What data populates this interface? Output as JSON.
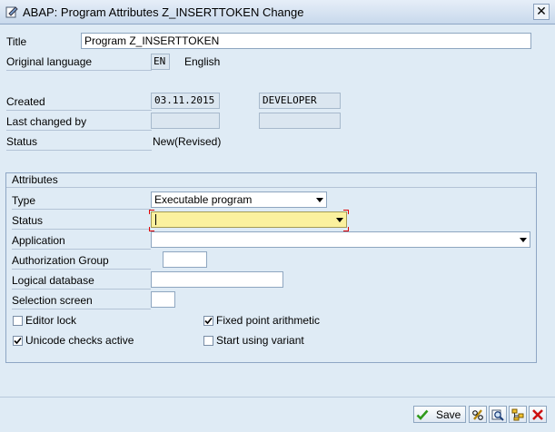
{
  "window": {
    "title": "ABAP: Program Attributes Z_INSERTTOKEN Change",
    "close_glyph": "✕"
  },
  "header": {
    "title_label": "Title",
    "title_value": "Program Z_INSERTTOKEN",
    "orig_lang_label": "Original language",
    "orig_lang_code": "EN",
    "orig_lang_name": "English",
    "created_label": "Created",
    "created_date": "03.11.2015",
    "created_user": "DEVELOPER",
    "last_changed_label": "Last changed by",
    "last_changed_date": "",
    "last_changed_user": "",
    "status_label": "Status",
    "status_value": "New(Revised)"
  },
  "attributes": {
    "group_title": "Attributes",
    "type_label": "Type",
    "type_value": "Executable program",
    "status_label": "Status",
    "status_value": "",
    "application_label": "Application",
    "application_value": "",
    "auth_group_label": "Authorization Group",
    "auth_group_value": "",
    "logical_db_label": "Logical database",
    "logical_db_value": "",
    "selection_screen_label": "Selection screen",
    "selection_screen_value": "",
    "editor_lock_label": "Editor lock",
    "editor_lock_checked": false,
    "fixed_point_label": "Fixed point arithmetic",
    "fixed_point_checked": true,
    "unicode_label": "Unicode checks active",
    "unicode_checked": true,
    "start_variant_label": "Start using variant",
    "start_variant_checked": false
  },
  "toolbar": {
    "save_label": "Save",
    "icons": [
      "check-icon",
      "pencil-glasses-icon",
      "where-used-icon",
      "hierarchy-icon",
      "cancel-icon"
    ]
  },
  "colors": {
    "background": "#dfebf5",
    "required_field": "#fbf19e",
    "required_marker": "#e00000",
    "checkmark": "#2f9a1b",
    "cancel": "#cc1010"
  }
}
